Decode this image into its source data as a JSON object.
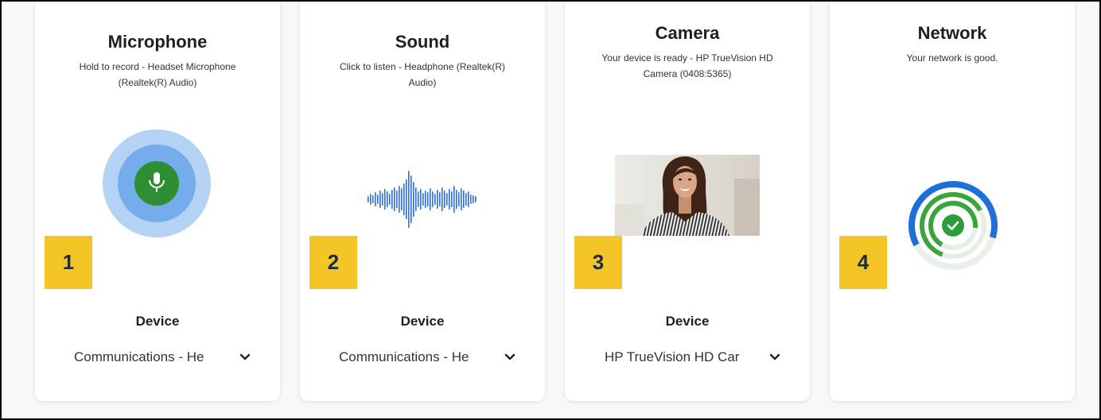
{
  "cards": [
    {
      "title": "Microphone",
      "subtitle": "Hold to record - Headset Microphone (Realtek(R) Audio)",
      "badge": "1",
      "device_label": "Device",
      "device_value": "Communications - He"
    },
    {
      "title": "Sound",
      "subtitle": "Click to listen - Headphone (Realtek(R) Audio)",
      "badge": "2",
      "device_label": "Device",
      "device_value": "Communications - He"
    },
    {
      "title": "Camera",
      "subtitle": "Your device is ready - HP TrueVision HD Camera (0408:5365)",
      "badge": "3",
      "device_label": "Device",
      "device_value": "HP TrueVision HD Car"
    },
    {
      "title": "Network",
      "subtitle": "Your network is good.",
      "badge": "4"
    }
  ],
  "icons": {
    "microphone": "microphone-icon",
    "sound": "waveform-icon",
    "camera": "camera-preview",
    "network": "network-status-icon",
    "dropdown": "chevron-down-icon",
    "network_ok": "check-icon"
  },
  "colors": {
    "badge": "#F4C526",
    "mic_green": "#2E8F32",
    "mic_ring_outer": "#B3D2F4",
    "mic_ring_inner": "#75ACEB",
    "wave_blue": "#2F6FDB",
    "network_blue": "#1E6FD9",
    "network_green": "#2C9C3C"
  }
}
